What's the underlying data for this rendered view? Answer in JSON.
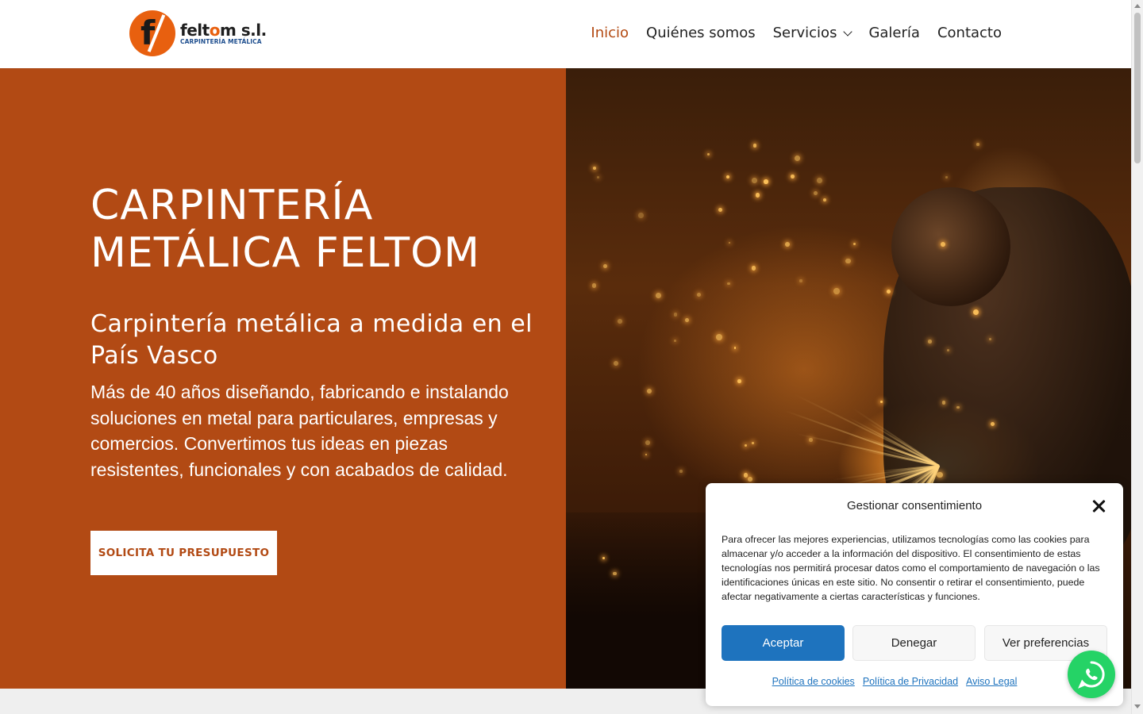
{
  "brand": {
    "logo_letter": "f",
    "name_prefix": "felt",
    "name_o": "o",
    "name_suffix": "m s.l.",
    "tagline": "CARPINTERÍA METÁLICA"
  },
  "nav": {
    "items": [
      {
        "label": "Inicio",
        "active": true
      },
      {
        "label": "Quiénes somos"
      },
      {
        "label": "Servicios",
        "has_dropdown": true
      },
      {
        "label": "Galería"
      },
      {
        "label": "Contacto"
      }
    ]
  },
  "hero": {
    "title": "CARPINTERÍA METÁLICA FELTOM",
    "subtitle": "Carpintería metálica a medida en el País Vasco",
    "text": "Más de 40 años diseñando, fabricando e instalando soluciones en metal para particulares, empresas y comercios. Convertimos tus ideas en piezas resistentes, funcionales y con acabados de calidad.",
    "cta_label": "SOLICITA TU PRESUPUESTO"
  },
  "cookie": {
    "title": "Gestionar consentimiento",
    "text": "Para ofrecer las mejores experiencias, utilizamos tecnologías como las cookies para almacenar y/o acceder a la información del dispositivo. El consentimiento de estas tecnologías nos permitirá procesar datos como el comportamiento de navegación o las identificaciones únicas en este sitio. No consentir o retirar el consentimiento, puede afectar negativamente a ciertas características y funciones.",
    "accept_label": "Aceptar",
    "deny_label": "Denegar",
    "prefs_label": "Ver preferencias",
    "links": [
      "Política de cookies",
      "Política de Privacidad",
      "Aviso Legal"
    ]
  },
  "colors": {
    "hero_bg": "#b24a14",
    "accent_orange": "#e8600f",
    "nav_active": "#b34a12",
    "button_blue": "#1e73be",
    "whatsapp_green": "#25d366"
  },
  "icons": {
    "close": "close-icon",
    "chevron": "chevron-down-icon",
    "whatsapp": "whatsapp-icon"
  }
}
